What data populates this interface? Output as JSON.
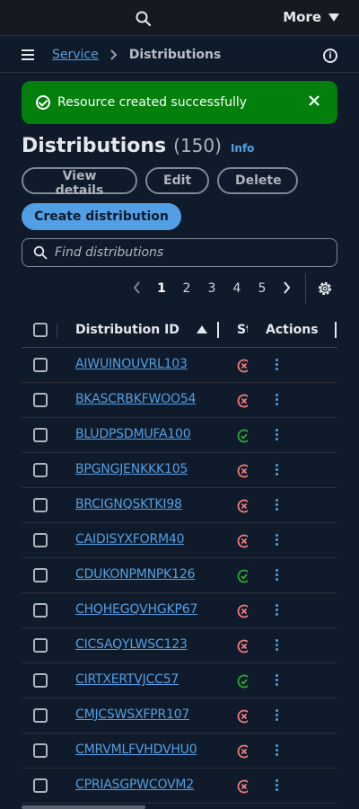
{
  "topbar": {
    "more_label": "More"
  },
  "breadcrumb": {
    "service": "Service",
    "current": "Distributions"
  },
  "flash": {
    "message": "Resource created successfully"
  },
  "header": {
    "title": "Distributions",
    "count": "(150)",
    "info": "Info"
  },
  "actions": {
    "view_details": "View details",
    "edit": "Edit",
    "delete": "Delete",
    "create": "Create distribution"
  },
  "search": {
    "placeholder": "Find distributions"
  },
  "pagination": {
    "pages": [
      "1",
      "2",
      "3",
      "4",
      "5"
    ],
    "current": "1"
  },
  "table": {
    "columns": {
      "id": "Distribution ID",
      "status": "Status",
      "actions": "Actions"
    },
    "sort": "ascending",
    "rows": [
      {
        "id": "AIWUINOUVRL103",
        "status": "error"
      },
      {
        "id": "BKASCRBKFWOO54",
        "status": "error"
      },
      {
        "id": "BLUDPSDMUFA100",
        "status": "success"
      },
      {
        "id": "BPGNGJENKKK105",
        "status": "error"
      },
      {
        "id": "BRCIGNQSKTKI98",
        "status": "error"
      },
      {
        "id": "CAIDISYXFORM40",
        "status": "error"
      },
      {
        "id": "CDUKONPMNPK126",
        "status": "success"
      },
      {
        "id": "CHQHEGQVHGKP67",
        "status": "error"
      },
      {
        "id": "CICSAQYLWSC123",
        "status": "error"
      },
      {
        "id": "CIRTXERTVJCC57",
        "status": "success"
      },
      {
        "id": "CMJCSWSXFPR107",
        "status": "error"
      },
      {
        "id": "CMRVMLFVHDVHU0",
        "status": "error"
      },
      {
        "id": "CPRIASGPWCOVM2",
        "status": "error"
      }
    ]
  },
  "colors": {
    "accent": "#539fe5",
    "success": "#037f0c",
    "error": "#f27b7b",
    "ok_icon": "#29ad32"
  }
}
